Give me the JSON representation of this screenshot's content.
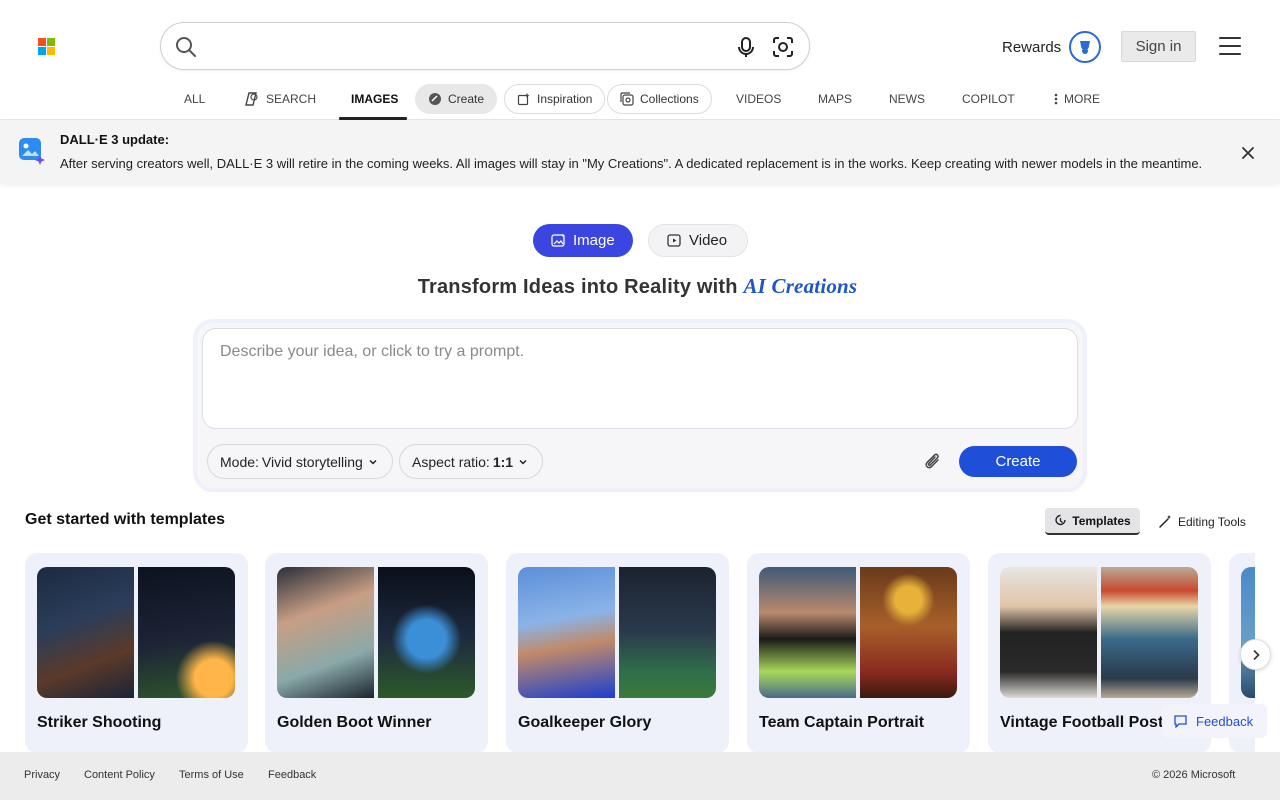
{
  "header": {
    "search_value": "",
    "rewards_label": "Rewards",
    "sign_in_label": "Sign in"
  },
  "nav": {
    "all": "ALL",
    "search": "SEARCH",
    "images": "IMAGES",
    "create": "Create",
    "inspiration": "Inspiration",
    "collections": "Collections",
    "videos": "VIDEOS",
    "maps": "MAPS",
    "news": "NEWS",
    "copilot": "COPILOT",
    "more": "MORE"
  },
  "banner": {
    "title": "DALL·E 3 update:",
    "text": "After serving creators well, DALL·E 3 will retire in the coming weeks. All images will stay in \"My Creations\". A dedicated replacement is in the works. Keep creating with newer models in the meantime."
  },
  "creator": {
    "image_tab": "Image",
    "video_tab": "Video",
    "heading": "Transform Ideas into Reality with",
    "heading_accent": "AI Creations",
    "prompt_placeholder": "Describe your idea, or click to try a prompt.",
    "mode_label": "Mode:",
    "mode_value": "Vivid storytelling",
    "aspect_label": "Aspect ratio:",
    "aspect_value": "1:1",
    "create_label": "Create"
  },
  "templates": {
    "title": "Get started with templates",
    "tab_templates": "Templates",
    "tab_editing": "Editing Tools",
    "cards": [
      {
        "label": "Striker Shooting"
      },
      {
        "label": "Golden Boot Winner"
      },
      {
        "label": "Goalkeeper Glory"
      },
      {
        "label": "Team Captain Portrait"
      },
      {
        "label": "Vintage Football Post"
      }
    ]
  },
  "feedback_float": "Feedback",
  "footer": {
    "privacy": "Privacy",
    "content_policy": "Content Policy",
    "terms": "Terms of Use",
    "feedback": "Feedback",
    "copyright": "© 2026 Microsoft"
  },
  "colors": {
    "accent_blue": "#3b45e0",
    "create_blue": "#1f4fd8",
    "ms_red": "#f25022",
    "ms_green": "#7fba00",
    "ms_blue": "#00a4ef",
    "ms_yellow": "#ffb900"
  },
  "icons": [
    "microsoft-logo",
    "search-icon",
    "mic-icon",
    "visual-search-icon",
    "rewards-icon",
    "hamburger-menu-icon",
    "copilot-search-icon",
    "create-brush-icon",
    "inspiration-icon",
    "collections-icon",
    "more-dots-icon",
    "banner-app-icon",
    "close-icon",
    "image-icon",
    "video-icon",
    "chevron-down-icon",
    "paperclip-icon",
    "templates-icon",
    "magic-wand-icon",
    "chevron-right-icon",
    "feedback-icon"
  ]
}
